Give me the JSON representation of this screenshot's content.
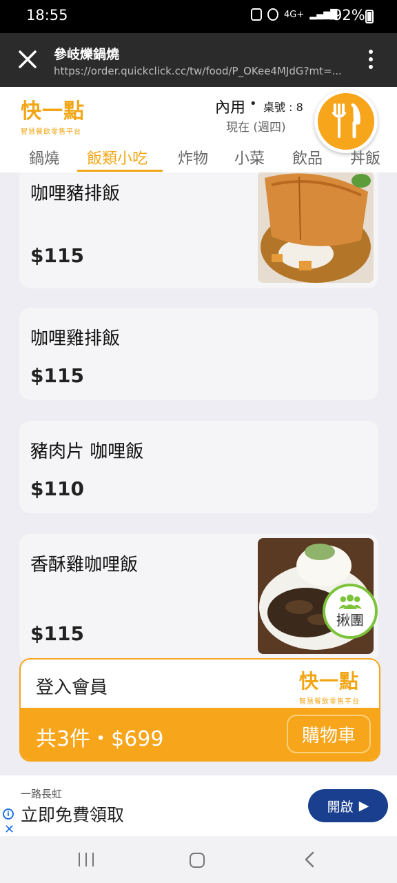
{
  "status": {
    "time": "18:55",
    "network": "4G+",
    "battery": "92%"
  },
  "browser": {
    "title": "參岐爍鍋燒",
    "url": "https://order.quickclick.cc/tw/food/P_OKee4MJdG?mt=..."
  },
  "header": {
    "logo": "快一點",
    "logo_sub": "智慧餐飲零售平台",
    "dine_mode": "內用",
    "dot": "•",
    "table": "桌號 : 8",
    "time": "現在 (週四)"
  },
  "tabs": [
    {
      "label": "鍋燒"
    },
    {
      "label": "飯類小吃"
    },
    {
      "label": "炸物"
    },
    {
      "label": "小菜"
    },
    {
      "label": "飲品"
    },
    {
      "label": "丼飯"
    }
  ],
  "items": [
    {
      "name": "咖哩豬排飯",
      "price": "$115"
    },
    {
      "name": "咖哩雞排飯",
      "price": "$115"
    },
    {
      "name": "豬肉片 咖哩飯",
      "price": "$110"
    },
    {
      "name": "香酥雞咖哩飯",
      "price": "$115"
    }
  ],
  "group_badge": {
    "label": "揪團"
  },
  "member": {
    "login": "登入會員",
    "logo": "快一點",
    "logo_sub": "智慧餐飲零售平台"
  },
  "cart": {
    "summary": "共3件・$699",
    "button": "購物車"
  },
  "ad": {
    "brand": "一路長虹",
    "title": "立即免費領取",
    "button": "開啟"
  },
  "colors": {
    "accent": "#f7a51b",
    "ad_button": "#1a3f8e"
  }
}
